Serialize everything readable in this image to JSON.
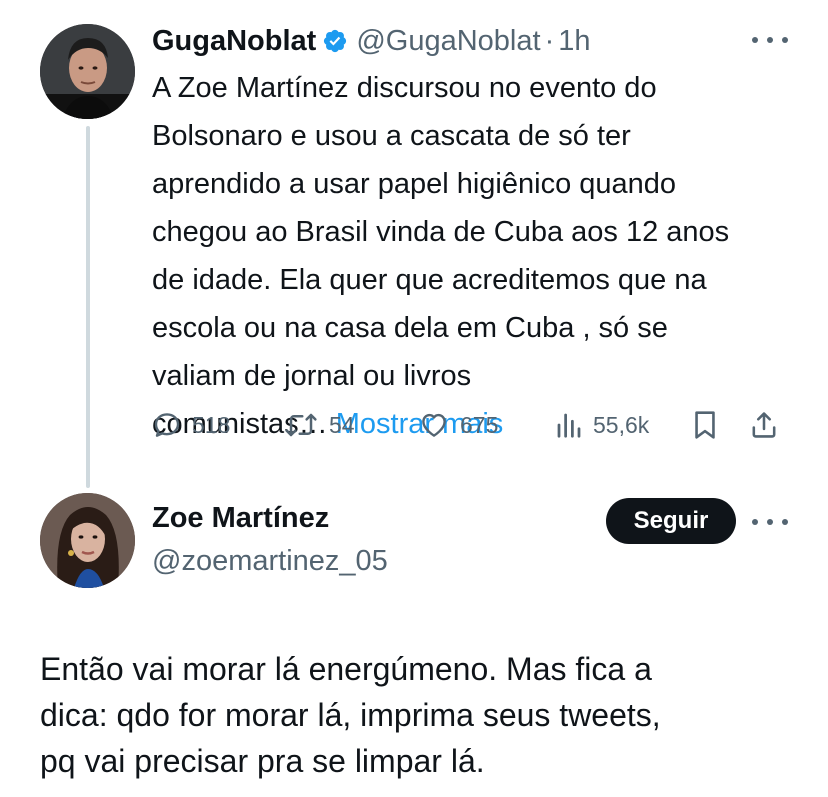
{
  "tweet1": {
    "display_name": "GugaNoblat",
    "handle": "@GugaNoblat",
    "separator": "·",
    "time": "1h",
    "verified": true,
    "body_lines": [
      "A Zoe Martínez discursou no evento do",
      "Bolsonaro e usou a cascata de só ter",
      "aprendido a usar papel higiênico quando",
      "chegou ao Brasil vinda de Cuba aos 12 anos",
      "de idade. Ela quer que acreditemos que na",
      "escola ou na casa dela em Cuba , só se",
      "valiam de jornal ou livros"
    ],
    "body_last_line": "comunistas…",
    "show_more": "Mostrar mais",
    "actions": {
      "replies": "518",
      "retweets": "54",
      "likes": "675",
      "views": "55,6k"
    }
  },
  "tweet2": {
    "display_name": "Zoe Martínez",
    "handle": "@zoemartinez_05",
    "follow_label": "Seguir",
    "body_lines": [
      "Então vai morar lá energúmeno. Mas fica a",
      "dica: qdo for morar lá, imprima seus tweets,",
      "pq vai precisar pra se limpar lá."
    ]
  },
  "colors": {
    "text_primary": "#0f1419",
    "text_secondary": "#536471",
    "accent": "#1d9bf0",
    "thread_line": "#cfd9de"
  },
  "icons": {
    "verified": "verified-badge-icon",
    "more": "more-dots-icon",
    "reply": "reply-icon",
    "retweet": "retweet-icon",
    "like": "heart-icon",
    "views": "views-icon",
    "bookmark": "bookmark-icon",
    "share": "share-icon"
  }
}
